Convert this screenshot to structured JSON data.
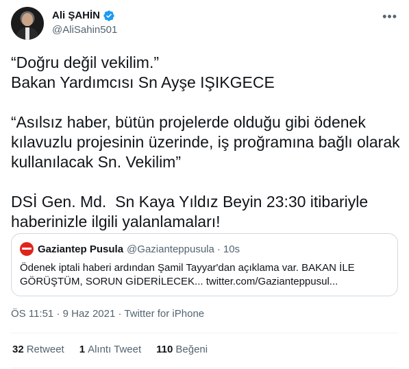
{
  "author": {
    "display_name": "Ali ŞAHİN",
    "handle": "@AliSahin501"
  },
  "tweet": {
    "text": "“Doğru değil vekilim.”\nBakan Yardımcısı Sn Ayşe IŞIKGECE\n\n“Asılsız haber, bütün projelerde olduğu gibi ödenek kılavuzlu projesinin üzerinde, iş proğramına bağlı olarak kullanılacak Sn. Vekilim”\n\nDSİ Gen. Md.  Sn Kaya Yıldız Beyin 23:30 itibariyle haberinizle ilgili yalanlamaları!"
  },
  "quote": {
    "name": "Gaziantep Pusula",
    "handle": "@Gazianteppusula",
    "dot": "·",
    "time": "10s",
    "text": "Ödenek iptali haberi ardından Şamil Tayyar'dan açıklama var. BAKAN İLE GÖRÜŞTÜM, SORUN GİDERİLECEK... twitter.com/Gazianteppusul..."
  },
  "meta": {
    "time": "ÖS 11:51",
    "dot1": "·",
    "date": "9 Haz 2021",
    "dot2": "·",
    "source": "Twitter for iPhone"
  },
  "stats": {
    "retweets_count": "32",
    "retweets_label": "Retweet",
    "quotes_count": "1",
    "quotes_label": "Alıntı Tweet",
    "likes_count": "110",
    "likes_label": "Beğeni"
  },
  "icons": {
    "verified": "verified-badge-icon",
    "more": "more-horizontal-icon"
  },
  "colors": {
    "text": "#0f1419",
    "secondary": "#536471",
    "verified": "#1d9bf0",
    "border": "#cfd9de",
    "quote_logo": "#e0241b"
  }
}
